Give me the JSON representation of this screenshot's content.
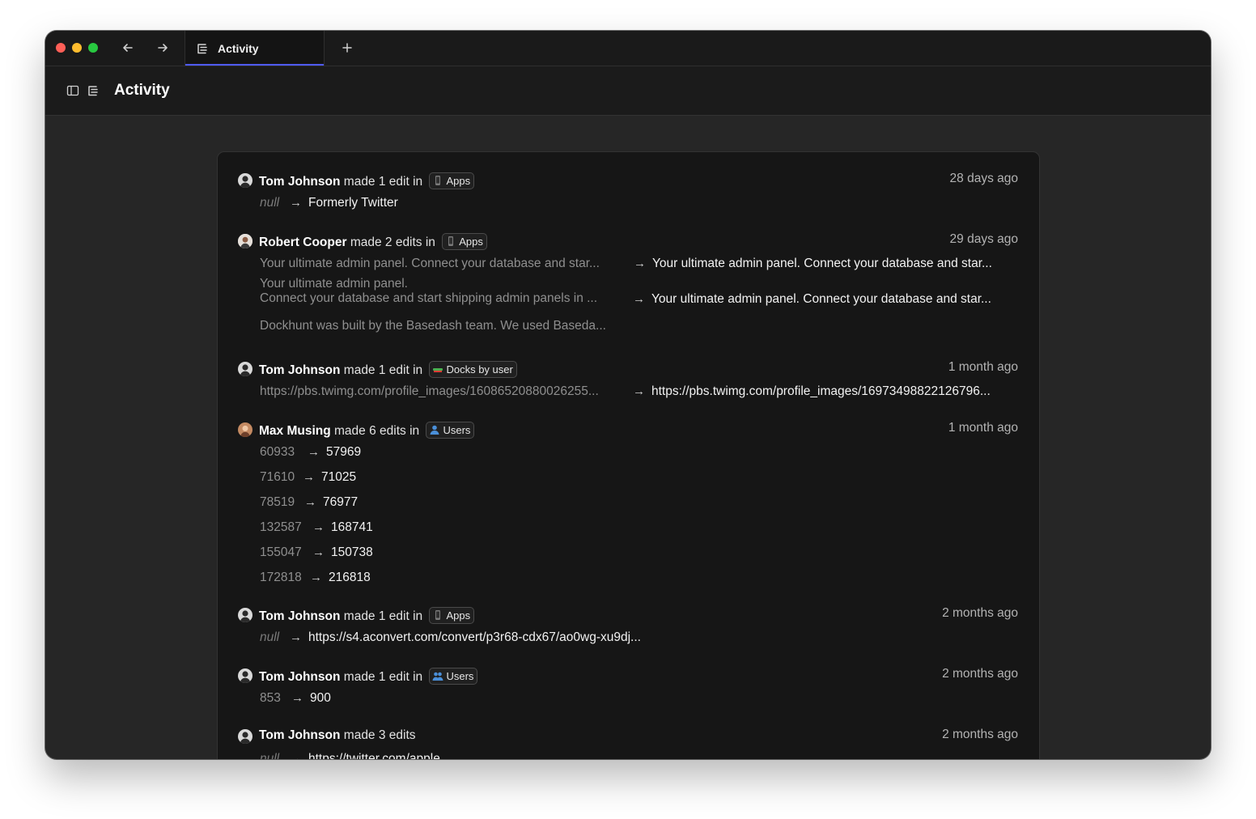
{
  "tab": {
    "label": "Activity"
  },
  "header": {
    "title": "Activity"
  },
  "entries": [
    {
      "user": "Tom Johnson",
      "action": "made 1 edit in",
      "table": "Apps",
      "table_icon": "mobile-phone-icon",
      "time": "28 days ago",
      "changes": [
        {
          "old": "null",
          "new": "Formerly Twitter"
        }
      ]
    },
    {
      "user": "Robert Cooper",
      "action": "made 2 edits in",
      "table": "Apps",
      "table_icon": "mobile-phone-icon",
      "time": "29 days ago",
      "changes": [
        {
          "old": "Your ultimate admin panel.  Connect your database and star...",
          "new": "Your ultimate admin panel.  Connect your database and star..."
        },
        {
          "old_line1": "Your ultimate admin panel.",
          "old_line2": "Connect your database and start shipping admin panels in ...",
          "new": "Your ultimate admin panel.  Connect your database and star..."
        },
        {
          "old": "Dockhunt was built by the Basedash team. We used Baseda..."
        }
      ]
    },
    {
      "user": "Tom Johnson",
      "action": "made 1 edit in",
      "table": "Docks by user",
      "table_icon": "dock-icon",
      "time": "1 month ago",
      "changes": [
        {
          "old": "https://pbs.twimg.com/profile_images/16086520880026255...",
          "new": "https://pbs.twimg.com/profile_images/16973498822126796..."
        }
      ]
    },
    {
      "user": "Max Musing",
      "action": "made 6 edits in",
      "table": "Users",
      "table_icon": "user-icon",
      "time": "1 month ago",
      "changes": [
        {
          "old": "60933",
          "new": "57969"
        },
        {
          "old": "71610",
          "new": "71025"
        },
        {
          "old": "78519",
          "new": "76977"
        },
        {
          "old": "132587",
          "new": "168741"
        },
        {
          "old": "155047",
          "new": "150738"
        },
        {
          "old": "172818",
          "new": "216818"
        }
      ]
    },
    {
      "user": "Tom Johnson",
      "action": "made 1 edit in",
      "table": "Apps",
      "table_icon": "mobile-phone-icon",
      "time": "2 months ago",
      "changes": [
        {
          "old": "null",
          "new": "https://s4.aconvert.com/convert/p3r68-cdx67/ao0wg-xu9dj..."
        }
      ]
    },
    {
      "user": "Tom Johnson",
      "action": "made 1 edit in",
      "table": "Users",
      "table_icon": "users-icon",
      "time": "2 months ago",
      "changes": [
        {
          "old": "853",
          "new": "900"
        }
      ]
    },
    {
      "user": "Tom Johnson",
      "action": "made 3 edits",
      "time": "2 months ago",
      "changes": [
        {
          "old": "null",
          "new": "https://twitter.com/apple"
        }
      ]
    }
  ],
  "arrow_glyph": "→"
}
